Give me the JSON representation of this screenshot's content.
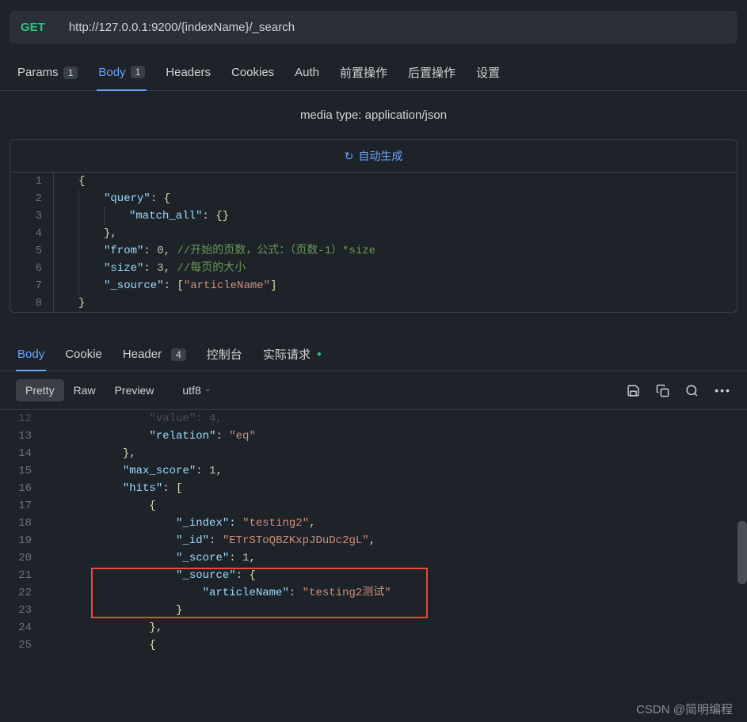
{
  "request": {
    "method": "GET",
    "url": "http://127.0.0.1:9200/{indexName}/_search"
  },
  "tabs": {
    "params": {
      "label": "Params",
      "badge": "1"
    },
    "body": {
      "label": "Body",
      "badge": "1"
    },
    "headers": {
      "label": "Headers"
    },
    "cookies": {
      "label": "Cookies"
    },
    "auth": {
      "label": "Auth"
    },
    "pre": {
      "label": "前置操作"
    },
    "post": {
      "label": "后置操作"
    },
    "settings": {
      "label": "设置"
    }
  },
  "media_type": "media type: application/json",
  "auto_gen": "自动生成",
  "req_gutter": {
    "l1": "1",
    "l2": "2",
    "l3": "3",
    "l4": "4",
    "l5": "5",
    "l6": "6",
    "l7": "7",
    "l8": "8"
  },
  "code_req": {
    "br_o": "{",
    "br_c": "}",
    "sq_o": "[",
    "sq_c": "]",
    "col": ": ",
    "com": ",",
    "query": "\"query\"",
    "match_all": "\"match_all\"",
    "empty": "{}",
    "from": "\"from\"",
    "from_v": "0",
    "from_c": "//开始的页数，公式：（页数-1）*size",
    "size": "\"size\"",
    "size_v": "3",
    "size_c": "//每页的大小",
    "source": "\"_source\"",
    "article": "\"articleName\""
  },
  "resp_tabs": {
    "body": "Body",
    "cookie": "Cookie",
    "header": "Header",
    "header_badge": "4",
    "console": "控制台",
    "actual": "实际请求"
  },
  "toolbar": {
    "pretty": "Pretty",
    "raw": "Raw",
    "preview": "Preview",
    "encoding": "utf8"
  },
  "resp_gutter": {
    "l12": "12",
    "l13": "13",
    "l14": "14",
    "l15": "15",
    "l16": "16",
    "l17": "17",
    "l18": "18",
    "l19": "19",
    "l20": "20",
    "l21": "21",
    "l22": "22",
    "l23": "23",
    "l24": "24",
    "l25": "25"
  },
  "code_resp": {
    "br_o": "{",
    "br_c": "}",
    "sq_o": "[",
    "sq_c": "]",
    "col": ": ",
    "com": ",",
    "clipped": "\"value\": 4,",
    "relation": "\"relation\"",
    "relation_v": "\"eq\"",
    "max_score": "\"max_score\"",
    "max_score_v": "1",
    "hits": "\"hits\"",
    "index": "\"_index\"",
    "index_v": "\"testing2\"",
    "id": "\"_id\"",
    "id_v": "\"ETrSToQBZKxpJDuDc2gL\"",
    "score": "\"_score\"",
    "score_v": "1",
    "source": "\"_source\"",
    "article": "\"articleName\"",
    "article_v": "\"testing2测试\""
  },
  "watermark": "CSDN @简明编程"
}
